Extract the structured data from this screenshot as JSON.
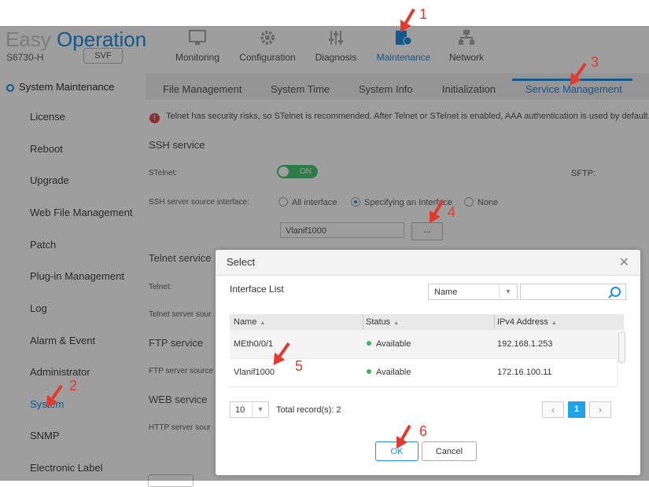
{
  "brand": {
    "easy": "Easy",
    "operation": "Operation"
  },
  "device": {
    "model": "S6730-H",
    "svf_label": "SVF"
  },
  "top_nav": [
    {
      "label": "Monitoring",
      "icon": "monitor-icon"
    },
    {
      "label": "Configuration",
      "icon": "gear-icon"
    },
    {
      "label": "Diagnosis",
      "icon": "sliders-icon"
    },
    {
      "label": "Maintenance",
      "icon": "maintenance-icon",
      "active": true
    },
    {
      "label": "Network",
      "icon": "network-icon"
    }
  ],
  "sidebar": {
    "header": "System Maintenance",
    "items": [
      {
        "label": "License"
      },
      {
        "label": "Reboot"
      },
      {
        "label": "Upgrade"
      },
      {
        "label": "Web File Management"
      },
      {
        "label": "Patch"
      },
      {
        "label": "Plug-in Management"
      },
      {
        "label": "Log"
      },
      {
        "label": "Alarm & Event"
      },
      {
        "label": "Administrator"
      },
      {
        "label": "System",
        "active": true
      },
      {
        "label": "SNMP"
      },
      {
        "label": "Electronic Label"
      }
    ]
  },
  "tabs": [
    {
      "label": "File Management"
    },
    {
      "label": "System Time"
    },
    {
      "label": "System Info"
    },
    {
      "label": "Initialization"
    },
    {
      "label": "Service Management",
      "active": true
    }
  ],
  "content": {
    "warning": "Telnet has security risks, so STelnet is recommended. After Telnet or STelnet is enabled, AAA authentication is used by default. M",
    "ssh_title": "SSH service",
    "stelnet_label": "STelnet:",
    "stelnet_toggle": "ON",
    "sftp_label": "SFTP:",
    "ssh_source_label": "SSH server source interface:",
    "radio_all": "All interface",
    "radio_specific": "Specifying an Interface",
    "radio_none": "None",
    "interface_value": "Vlanif1000",
    "browse_label": "...",
    "telnet_title": "Telnet service",
    "telnet_label": "Telnet:",
    "telnet_source_label": "Telnet server sour",
    "ftp_title": "FTP service",
    "ftp_source_label": "FTP server source",
    "web_title": "WEB service",
    "http_source_label": "HTTP server sour"
  },
  "dialog": {
    "title": "Select",
    "close_symbol": "✕",
    "subtitle": "Interface List",
    "filter_field": "Name",
    "search_placeholder": "",
    "columns": [
      "Name",
      "Status",
      "IPv4 Address"
    ],
    "rows": [
      {
        "name": "MEth0/0/1",
        "status": "Available",
        "ip": "192.168.1.253"
      },
      {
        "name": "Vlanif1000",
        "status": "Available",
        "ip": "172.16.100.11"
      }
    ],
    "page_size": "10",
    "total": "Total record(s): 2",
    "prev_symbol": "‹",
    "current_page": "1",
    "next_symbol": "›",
    "ok_label": "OK",
    "cancel_label": "Cancel"
  },
  "annotations": [
    "1",
    "2",
    "3",
    "4",
    "5",
    "6"
  ],
  "colors": {
    "accent": "#1f8fe0",
    "annotation": "#e23a2f",
    "status_available": "#3cb55c"
  }
}
